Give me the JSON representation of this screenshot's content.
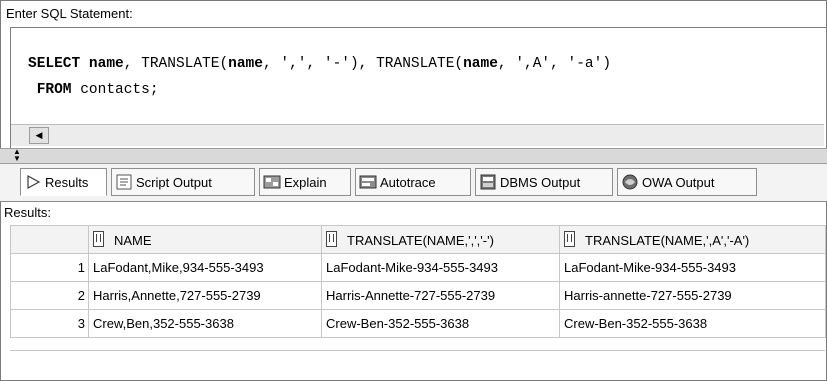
{
  "sql": {
    "label": "Enter SQL Statement:",
    "line1": {
      "kw_select": "SELECT",
      "col1": "name",
      "sep1": ", TRANSLATE(",
      "col2": "name",
      "sep2": ", ',', '-'), TRANSLATE(",
      "col3": "name",
      "sep3": ", ',A', '-a')"
    },
    "line2": {
      "kw_from": "FROM",
      "rest": " contacts;"
    }
  },
  "tabs": [
    {
      "label": "Results",
      "icon": "play-arrow-icon"
    },
    {
      "label": "Script Output",
      "icon": "script-output-icon"
    },
    {
      "label": "Explain",
      "icon": "explain-icon"
    },
    {
      "label": "Autotrace",
      "icon": "autotrace-icon"
    },
    {
      "label": "DBMS Output",
      "icon": "dbms-output-icon"
    },
    {
      "label": "OWA Output",
      "icon": "owa-output-icon"
    }
  ],
  "results": {
    "label": "Results:",
    "columns": [
      "NAME",
      "TRANSLATE(NAME,',','-')",
      "TRANSLATE(NAME,',A','-A')"
    ],
    "rows": [
      {
        "num": "1",
        "c1": "LaFodant,Mike,934-555-3493",
        "c2": "LaFodant-Mike-934-555-3493",
        "c3": "LaFodant-Mike-934-555-3493"
      },
      {
        "num": "2",
        "c1": "Harris,Annette,727-555-2739",
        "c2": "Harris-Annette-727-555-2739",
        "c3": "Harris-annette-727-555-2739"
      },
      {
        "num": "3",
        "c1": "Crew,Ben,352-555-3638",
        "c2": "Crew-Ben-352-555-3638",
        "c3": "Crew-Ben-352-555-3638"
      }
    ]
  }
}
